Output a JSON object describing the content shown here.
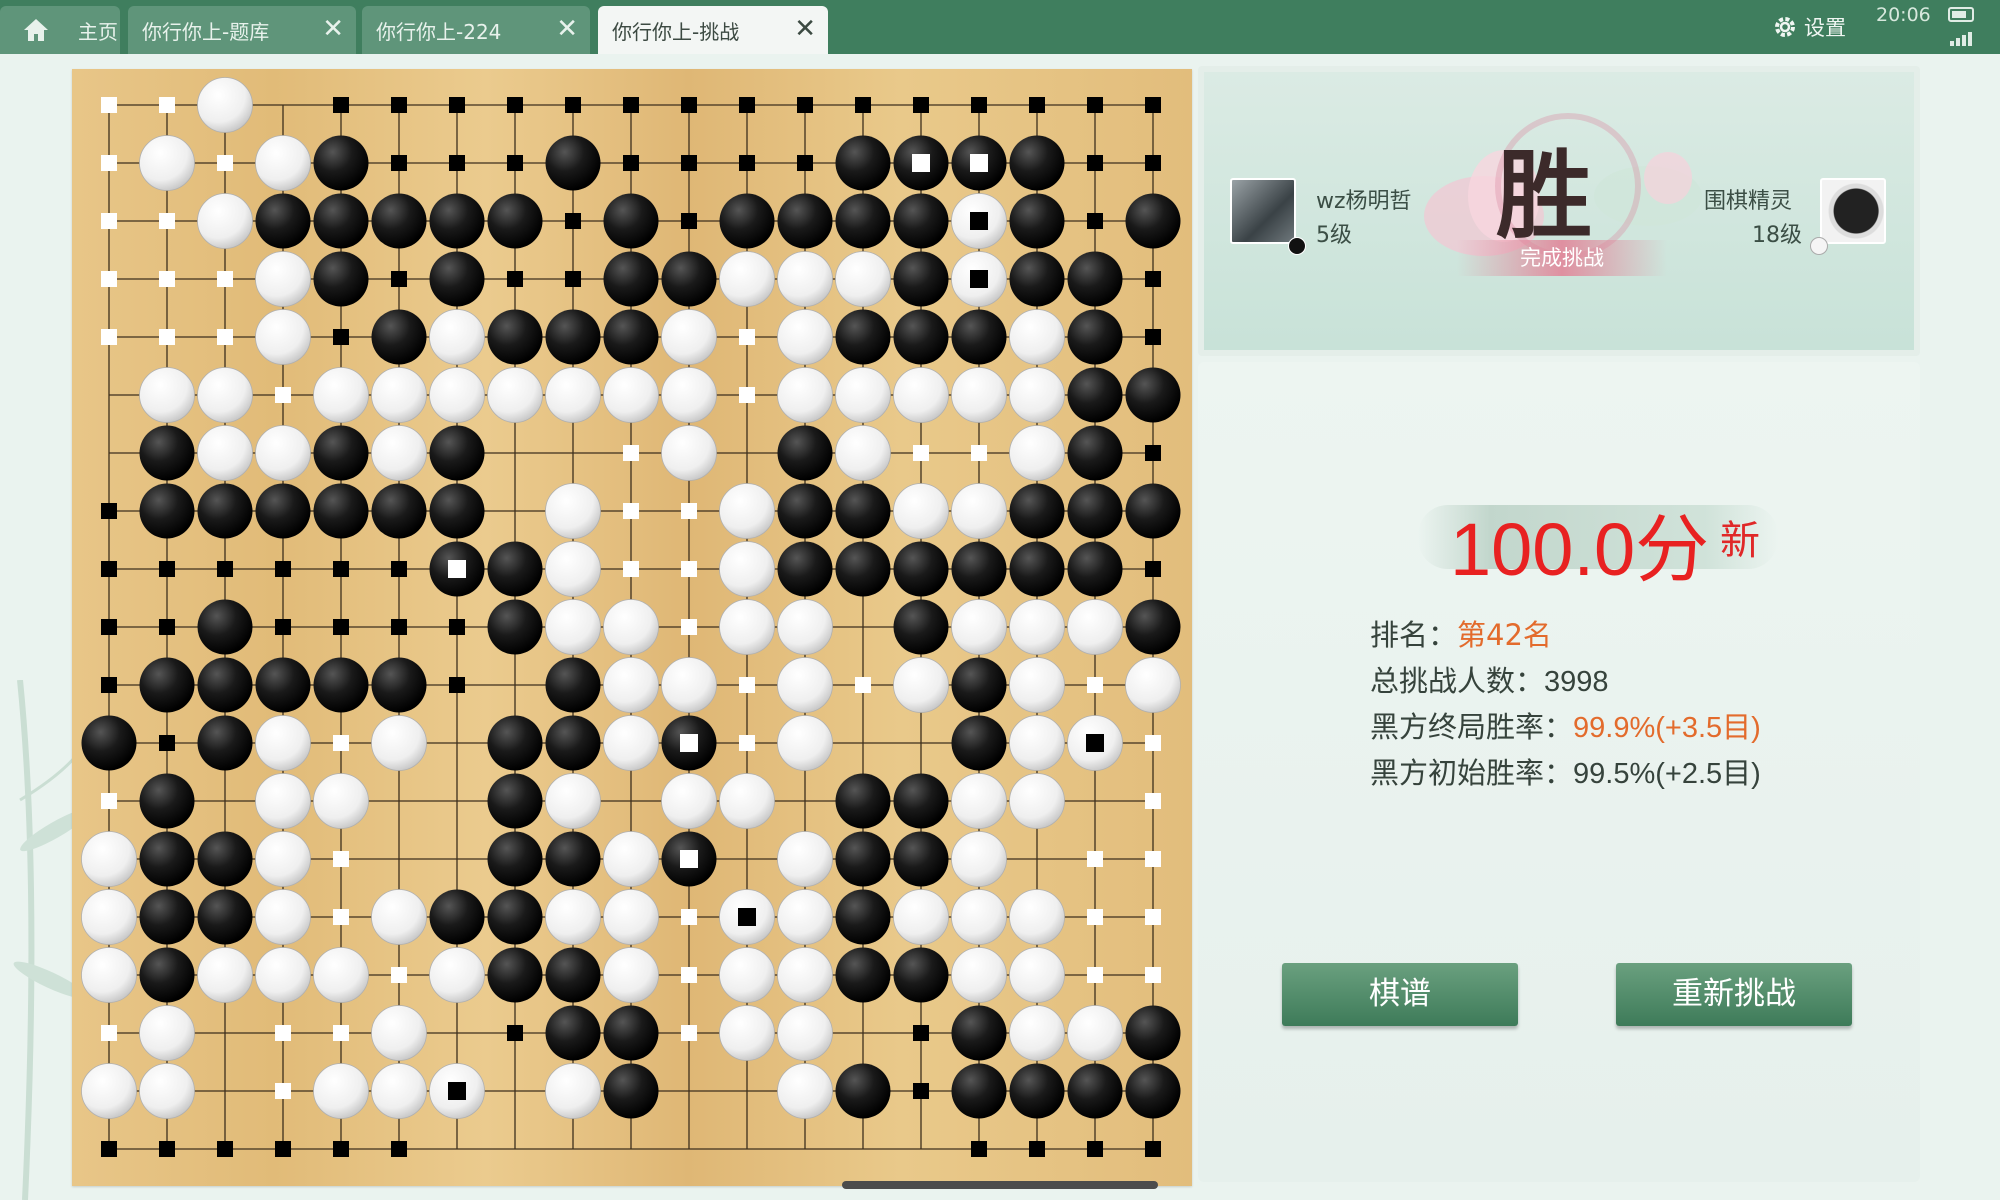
{
  "tabs": [
    {
      "label": "主页",
      "icon": "home-icon"
    },
    {
      "label": "你行你上-题库"
    },
    {
      "label": "你行你上-224"
    },
    {
      "label": "你行你上-挑战",
      "active": true
    }
  ],
  "status_bar": {
    "settings_label": "设置",
    "time": "20:06"
  },
  "result": {
    "player_black": {
      "name": "wz杨明哲",
      "level": "5级"
    },
    "player_white": {
      "name": "围棋精灵",
      "level": "18级"
    },
    "outcome": "胜",
    "outcome_caption": "完成挑战"
  },
  "score": {
    "value": "100.0分",
    "badge": "新"
  },
  "stats": {
    "rank_label": "排名：",
    "rank_value": "第42名",
    "total_label": "总挑战人数：",
    "total_value": "3998",
    "final_label": "黑方终局胜率：",
    "final_value": "99.9%(+3.5目)",
    "initial_label": "黑方初始胜率：",
    "initial_value": "99.5%(+2.5目)"
  },
  "buttons": {
    "record": "棋谱",
    "retry": "重新挑战"
  },
  "colors": {
    "accent_green": "#3f7e5e",
    "score_red": "#e82121",
    "highlight_orange": "#e36b2c"
  },
  "board": {
    "size": 19,
    "legend": "B=black stone, W=white stone, b/w=territory marker, X/O=dead marked stone, L=last move marker",
    "rows": [
      "wwW.bbbbbbbbbbbbbbb",
      "wWwWBbbbBbbbbBXXBbb",
      "wwWBBBBBbBbBBBBOBbB",
      "wwwWBbBbbBBWWWBOBBb",
      "wwwWbBWBBBWwWBBBWBb",
      ".WWwWWWWWWWwWWWWWBB",
      ".BWWBWB..wW.BWwwWBb",
      "bBBBBBB.WwwWBBWWBBBb",
      "bbbbbbXBWwwWBBBBBBb",
      "bbBbbbbBWWwWW.BWWWB",
      "bBBBBBb.BWWwWwWBWwWL",
      "BbBWwW.BBWXwW..BWOww",
      "wB.WW..BW.WW.BBWW.w",
      "WBBWw..BBWX.WBBW.ww",
      "WBBWwWBBWWwOWBWWWww",
      "WBWWWwWBBWwWWBBWWww",
      "wW.wwW.bBBwWW.bBWWB",
      "WW.wWWO.WB..WBbBBBBB",
      "bbbbbb.........bbbbbb"
    ]
  }
}
